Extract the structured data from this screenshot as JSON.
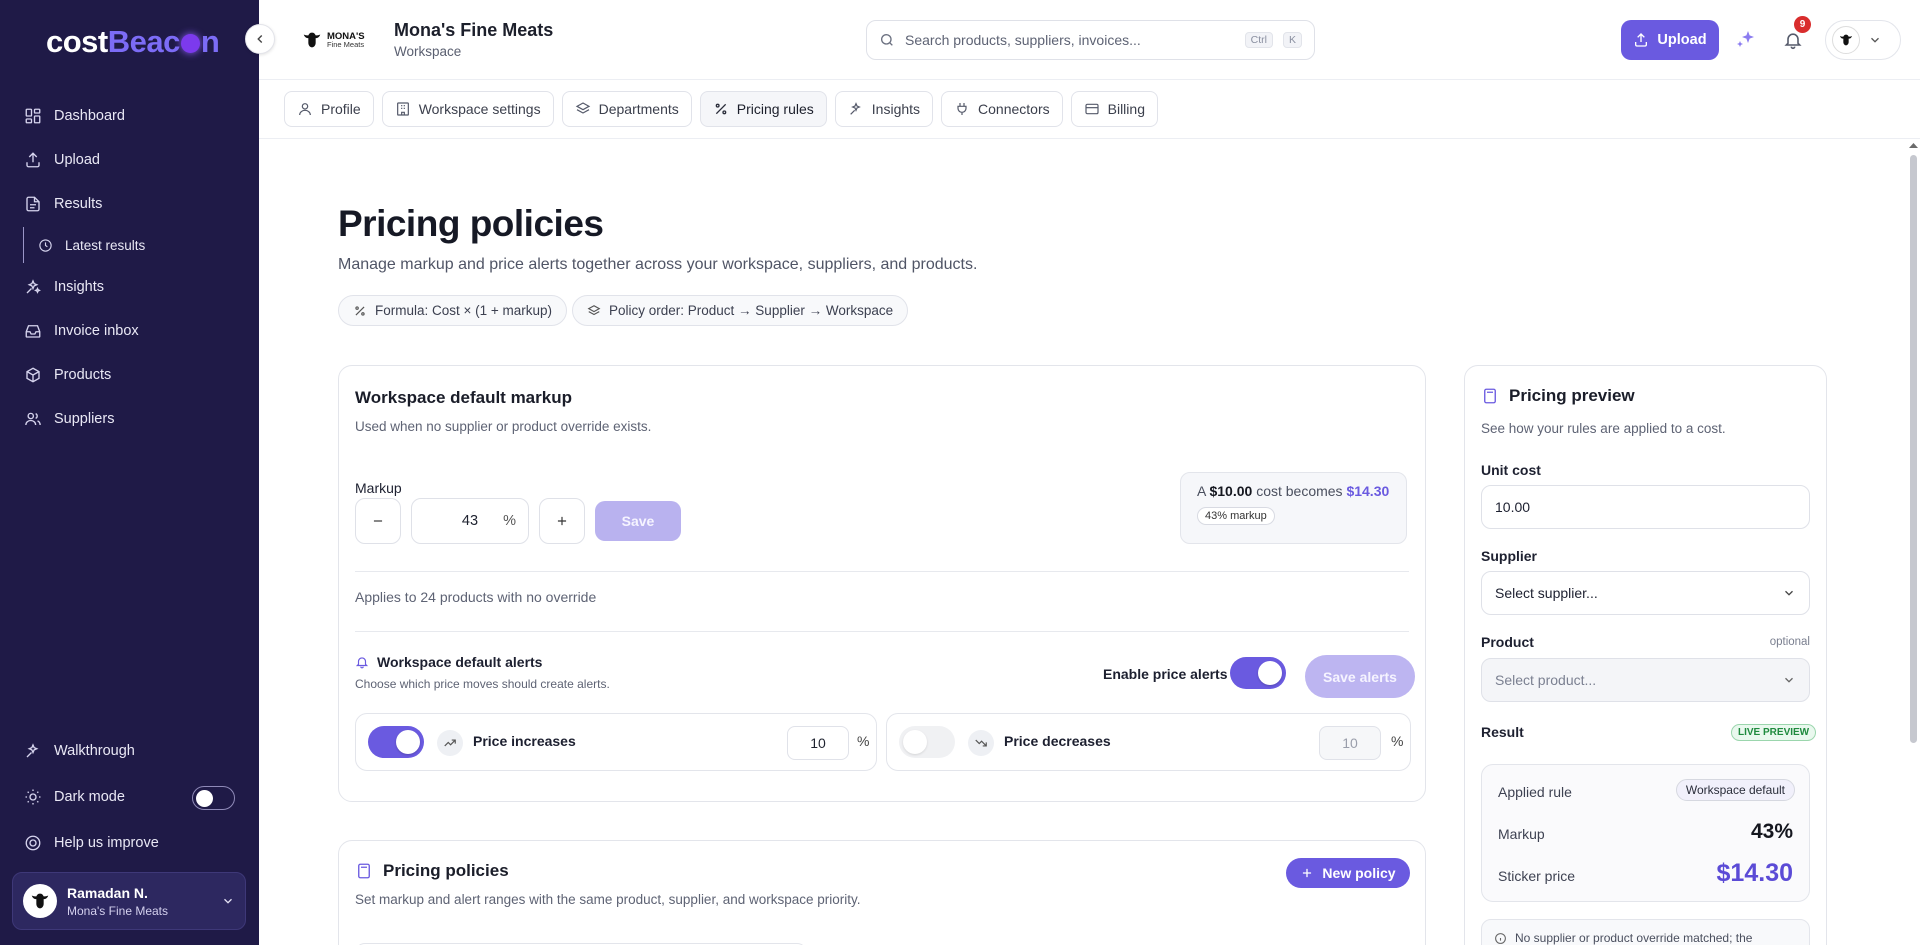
{
  "sidebar": {
    "logo_part1": "cost",
    "logo_part2": "Beac",
    "logo_part3": "n",
    "items": [
      {
        "label": "Dashboard",
        "icon": "dashboard-icon"
      },
      {
        "label": "Upload",
        "icon": "upload-icon"
      },
      {
        "label": "Results",
        "icon": "file-icon"
      },
      {
        "label": "Latest results",
        "icon": "clock-icon"
      },
      {
        "label": "Insights",
        "icon": "sparkles-icon"
      },
      {
        "label": "Invoice inbox",
        "icon": "inbox-icon"
      },
      {
        "label": "Products",
        "icon": "box-icon"
      },
      {
        "label": "Suppliers",
        "icon": "users-icon"
      }
    ],
    "bottom": {
      "walkthrough": "Walkthrough",
      "dark_mode": "Dark mode",
      "help": "Help us improve"
    },
    "user": {
      "name": "Ramadan N.",
      "org": "Mona's Fine Meats"
    }
  },
  "header": {
    "brand_line1": "MONA'S",
    "brand_line2": "Fine Meats",
    "workspace_title": "Mona's Fine Meats",
    "workspace_sub": "Workspace",
    "search_placeholder": "Search products, suppliers, invoices...",
    "kbd_ctrl": "Ctrl",
    "kbd_k": "K",
    "upload_label": "Upload",
    "notifications_count": "9",
    "avatar_text": "MONA'S"
  },
  "tabs": [
    {
      "label": "Profile"
    },
    {
      "label": "Workspace settings"
    },
    {
      "label": "Departments"
    },
    {
      "label": "Pricing rules"
    },
    {
      "label": "Insights"
    },
    {
      "label": "Connectors"
    },
    {
      "label": "Billing"
    }
  ],
  "page": {
    "title": "Pricing policies",
    "subtitle": "Manage markup and price alerts together across your workspace, suppliers, and products.",
    "chip_formula": "Formula: Cost × (1 + markup)",
    "chip_order": "Policy order: Product → Supplier → Workspace"
  },
  "default_markup": {
    "title": "Workspace default markup",
    "subtitle": "Used when no supplier or product override exists.",
    "markup_label": "Markup",
    "markup_value": "43",
    "pct": "%",
    "save_label": "Save",
    "becomes_a": "A",
    "becomes_cost": "$10.00",
    "becomes_mid": "cost becomes",
    "becomes_price": "$14.30",
    "markup_pill": "43% markup",
    "applies_text": "Applies to 24 products with no override",
    "alerts_title": "Workspace default alerts",
    "alerts_sub": "Choose which price moves should create alerts.",
    "enable_alerts_label": "Enable price alerts",
    "save_alerts_label": "Save alerts",
    "increases_label": "Price increases",
    "increases_value": "10",
    "decreases_label": "Price decreases",
    "decreases_value": "10",
    "alerts_enabled": true,
    "increases_enabled": true,
    "decreases_enabled": false
  },
  "policies": {
    "title": "Pricing policies",
    "subtitle": "Set markup and alert ranges with the same product, supplier, and workspace priority.",
    "new_policy_label": "New policy"
  },
  "preview": {
    "title": "Pricing preview",
    "subtitle": "See how your rules are applied to a cost.",
    "unit_cost_label": "Unit cost",
    "unit_cost_value": "10.00",
    "supplier_label": "Supplier",
    "supplier_placeholder": "Select supplier...",
    "product_label": "Product",
    "product_optional": "optional",
    "product_placeholder": "Select product...",
    "result_label": "Result",
    "live_label": "LIVE PREVIEW",
    "applied_rule_label": "Applied rule",
    "applied_rule_value": "Workspace default",
    "markup_label": "Markup",
    "markup_value": "43%",
    "sticker_label": "Sticker price",
    "sticker_value": "$14.30",
    "info_text": "No supplier or product override matched; the"
  },
  "colors": {
    "sidebar_bg": "#1f1a47",
    "accent": "#6a5ae0",
    "accent_disabled": "#b9b2ef",
    "badge": "#d92d2d",
    "live_green": "#1f8a3e"
  }
}
